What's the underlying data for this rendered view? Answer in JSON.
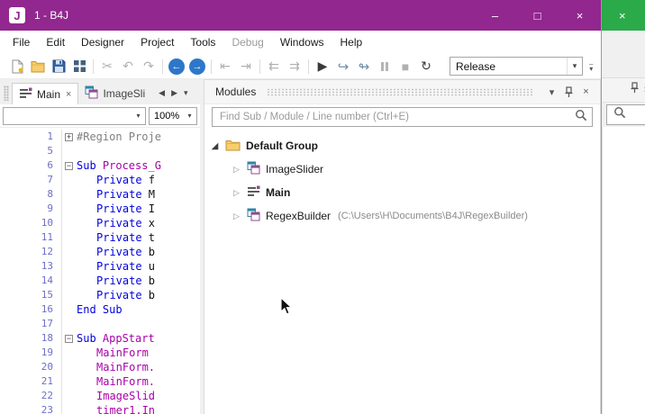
{
  "colors": {
    "titlebar": "#92278F",
    "bg_window_green": "#2BAA4A",
    "accent_blue": "#2E77C8"
  },
  "window": {
    "title": "1 - B4J",
    "icon_letter": "J",
    "controls": {
      "minimize": "–",
      "maximize": "□",
      "close": "×"
    }
  },
  "menu": {
    "items": [
      {
        "label": "File",
        "enabled": true
      },
      {
        "label": "Edit",
        "enabled": true
      },
      {
        "label": "Designer",
        "enabled": true
      },
      {
        "label": "Project",
        "enabled": true
      },
      {
        "label": "Tools",
        "enabled": true
      },
      {
        "label": "Debug",
        "enabled": false
      },
      {
        "label": "Windows",
        "enabled": true
      },
      {
        "label": "Help",
        "enabled": true
      }
    ]
  },
  "toolbar": {
    "build_config": "Release",
    "icons": [
      "new-file-icon",
      "open-project-icon",
      "save-icon",
      "modules-grid-icon",
      "cut-icon",
      "undo-icon",
      "redo-icon",
      "navigate-back-icon",
      "navigate-forward-icon",
      "indent-decrease-icon",
      "indent-increase-icon",
      "previous-sub-icon",
      "next-sub-icon",
      "run-icon",
      "step-into-icon",
      "step-over-icon",
      "pause-icon",
      "stop-icon",
      "restart-icon",
      "toolbar-overflow-icon"
    ],
    "glyphs": {
      "cut": "✂",
      "undo": "↶",
      "redo": "↷",
      "back": "←",
      "forward": "→",
      "indent_dec": "⇤",
      "indent_inc": "⇥",
      "prev_sub": "⇇",
      "next_sub": "⇉",
      "run": "▶",
      "step_into": "↪",
      "step_over": "↬",
      "stop": "■",
      "restart": "↻",
      "combo_arrow": "▾",
      "overflow_bar": "—",
      "overflow_arrow": "▾"
    }
  },
  "left_pane": {
    "tabs": [
      {
        "label": "Main",
        "close_glyph": "×",
        "active": true
      },
      {
        "label": "ImageSli",
        "active": false
      }
    ],
    "tab_nav": {
      "prev": "◀",
      "next": "▶",
      "menu": "▾"
    },
    "member_combo_value": "",
    "zoom_value": "100%",
    "combo_arrow": "▾"
  },
  "editor": {
    "colors": {
      "keyword": "#0000E0",
      "member": "#A800A8",
      "comment_region": "#808080",
      "line_number": "#6E6EC8"
    },
    "lines": [
      {
        "n": "1",
        "fold": "plus",
        "indent": 0,
        "segs": [
          {
            "t": "#Region Proje",
            "c": "gray"
          }
        ]
      },
      {
        "n": "5",
        "fold": null,
        "indent": 0,
        "segs": []
      },
      {
        "n": "6",
        "fold": "minus",
        "indent": 0,
        "segs": [
          {
            "t": "Sub ",
            "c": "kw"
          },
          {
            "t": "Process_G",
            "c": "name"
          }
        ]
      },
      {
        "n": "7",
        "fold": null,
        "indent": 1,
        "segs": [
          {
            "t": "Private ",
            "c": "kw"
          },
          {
            "t": "f",
            "c": "id"
          }
        ]
      },
      {
        "n": "8",
        "fold": null,
        "indent": 1,
        "segs": [
          {
            "t": "Private ",
            "c": "kw"
          },
          {
            "t": "M",
            "c": "id"
          }
        ]
      },
      {
        "n": "9",
        "fold": null,
        "indent": 1,
        "segs": [
          {
            "t": "Private ",
            "c": "kw"
          },
          {
            "t": "I",
            "c": "id"
          }
        ]
      },
      {
        "n": "10",
        "fold": null,
        "indent": 1,
        "segs": [
          {
            "t": "Private ",
            "c": "kw"
          },
          {
            "t": "x",
            "c": "id"
          }
        ]
      },
      {
        "n": "11",
        "fold": null,
        "indent": 1,
        "segs": [
          {
            "t": "Private ",
            "c": "kw"
          },
          {
            "t": "t",
            "c": "id"
          }
        ]
      },
      {
        "n": "12",
        "fold": null,
        "indent": 1,
        "segs": [
          {
            "t": "Private ",
            "c": "kw"
          },
          {
            "t": "b",
            "c": "id"
          }
        ]
      },
      {
        "n": "13",
        "fold": null,
        "indent": 1,
        "segs": [
          {
            "t": "Private ",
            "c": "kw"
          },
          {
            "t": "u",
            "c": "id"
          }
        ]
      },
      {
        "n": "14",
        "fold": null,
        "indent": 1,
        "segs": [
          {
            "t": "Private ",
            "c": "kw"
          },
          {
            "t": "b",
            "c": "id"
          }
        ]
      },
      {
        "n": "15",
        "fold": null,
        "indent": 1,
        "segs": [
          {
            "t": "Private ",
            "c": "kw"
          },
          {
            "t": "b",
            "c": "id"
          }
        ]
      },
      {
        "n": "16",
        "fold": null,
        "indent": 0,
        "segs": [
          {
            "t": "End Sub",
            "c": "kw"
          }
        ]
      },
      {
        "n": "17",
        "fold": null,
        "indent": 0,
        "segs": []
      },
      {
        "n": "18",
        "fold": "minus",
        "indent": 0,
        "segs": [
          {
            "t": "Sub ",
            "c": "kw"
          },
          {
            "t": "AppStart",
            "c": "name"
          }
        ]
      },
      {
        "n": "19",
        "fold": null,
        "indent": 1,
        "segs": [
          {
            "t": "MainForm",
            "c": "name"
          }
        ]
      },
      {
        "n": "20",
        "fold": null,
        "indent": 1,
        "segs": [
          {
            "t": "MainForm.",
            "c": "name"
          }
        ]
      },
      {
        "n": "21",
        "fold": null,
        "indent": 1,
        "segs": [
          {
            "t": "MainForm.",
            "c": "name"
          }
        ]
      },
      {
        "n": "22",
        "fold": null,
        "indent": 1,
        "segs": [
          {
            "t": "ImageSlid",
            "c": "name"
          }
        ]
      },
      {
        "n": "23",
        "fold": null,
        "indent": 1,
        "segs": [
          {
            "t": "timer1.In",
            "c": "name"
          }
        ]
      }
    ]
  },
  "modules_panel": {
    "title": "Modules",
    "menu_glyph": "▾",
    "close_glyph": "×",
    "search_placeholder": "Find Sub / Module / Line number (Ctrl+E)",
    "tree": [
      {
        "level": 0,
        "expander": "expanded",
        "icon": "folder",
        "label": "Default Group",
        "bold": true,
        "path": ""
      },
      {
        "level": 1,
        "expander": "collapsed",
        "icon": "module",
        "label": "ImageSlider",
        "bold": false,
        "path": ""
      },
      {
        "level": 1,
        "expander": "collapsed",
        "icon": "main",
        "label": "Main",
        "bold": true,
        "path": ""
      },
      {
        "level": 1,
        "expander": "collapsed",
        "icon": "module",
        "label": "RegexBuilder",
        "bold": false,
        "path": "(C:\\Users\\H\\Documents\\B4J\\RegexBuilder)"
      }
    ]
  },
  "background_window": {
    "close_glyph": "×"
  }
}
